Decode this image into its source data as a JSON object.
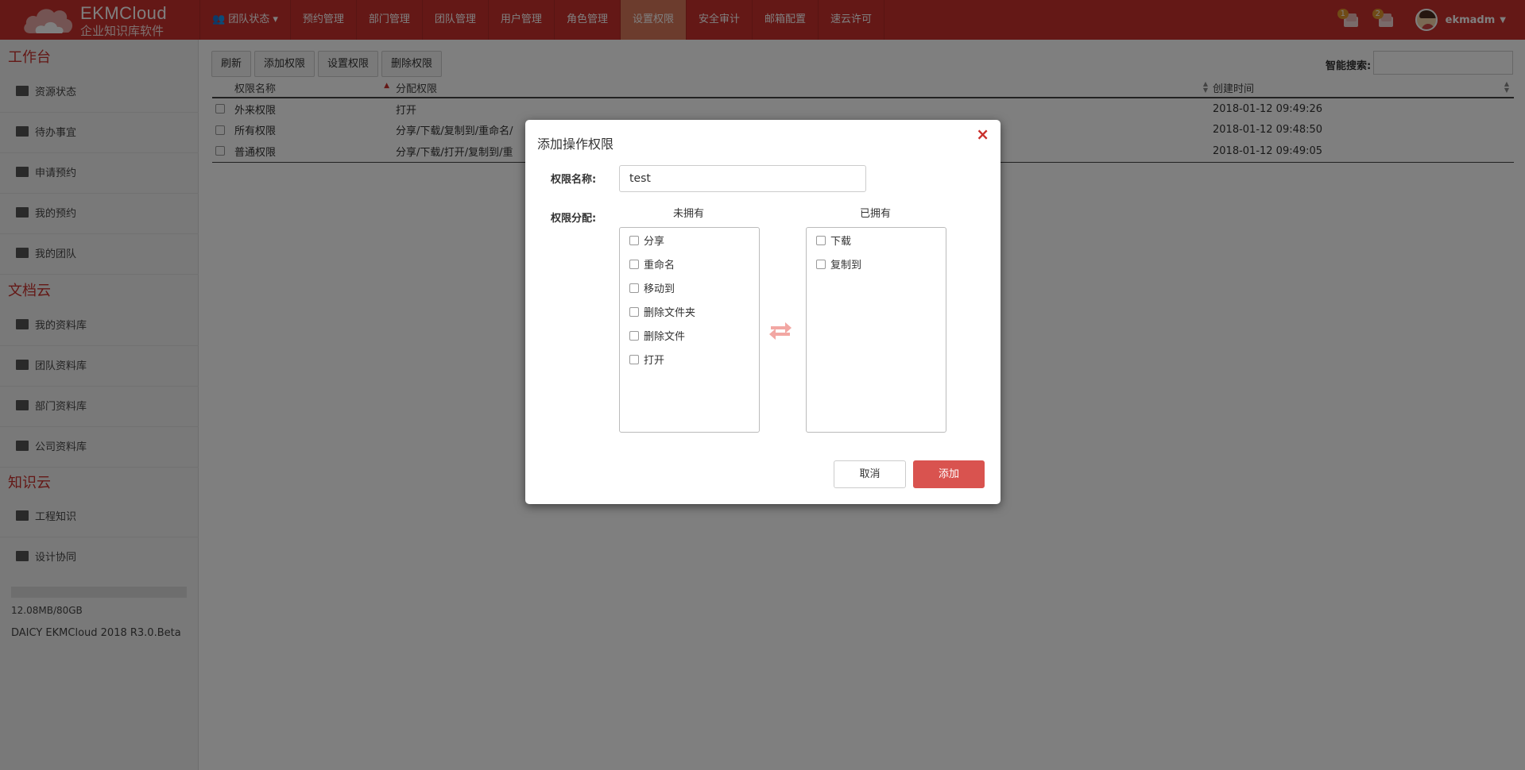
{
  "header": {
    "brand": "EKMCloud",
    "subtitle": "企业知识库软件",
    "nav": [
      {
        "label": "团队状态",
        "icon": "team-icon",
        "has_dropdown": true
      },
      {
        "label": "预约管理"
      },
      {
        "label": "部门管理"
      },
      {
        "label": "团队管理"
      },
      {
        "label": "用户管理"
      },
      {
        "label": "角色管理"
      },
      {
        "label": "设置权限",
        "active": true
      },
      {
        "label": "安全审计"
      },
      {
        "label": "邮箱配置"
      },
      {
        "label": "速云许可"
      }
    ],
    "messages": [
      {
        "count": "1"
      },
      {
        "count": "2"
      }
    ],
    "username": "ekmadm"
  },
  "sidebar": {
    "sections": [
      {
        "title": "工作台",
        "items": [
          "资源状态",
          "待办事宜",
          "申请预约",
          "我的预约",
          "我的团队"
        ]
      },
      {
        "title": "文档云",
        "items": [
          "我的资料库",
          "团队资料库",
          "部门资料库",
          "公司资料库"
        ]
      },
      {
        "title": "知识云",
        "items": [
          "工程知识",
          "设计协同"
        ]
      }
    ],
    "storage": "12.08MB/80GB",
    "version": "DAICY EKMCloud 2018 R3.0.Beta"
  },
  "toolbar": {
    "buttons": [
      "刷新",
      "添加权限",
      "设置权限",
      "删除权限"
    ],
    "search_label": "智能搜索:",
    "search_value": ""
  },
  "table": {
    "columns": [
      "权限名称",
      "分配权限",
      "创建时间"
    ],
    "rows": [
      {
        "name": "外来权限",
        "perms": "打开",
        "created": "2018-01-12 09:49:26"
      },
      {
        "name": "所有权限",
        "perms": "分享/下载/复制到/重命名/",
        "created": "2018-01-12 09:48:50"
      },
      {
        "name": "普通权限",
        "perms": "分享/下载/打开/复制到/重",
        "created": "2018-01-12 09:49:05"
      }
    ]
  },
  "modal": {
    "title": "添加操作权限",
    "close_glyph": "×",
    "name_label": "权限名称:",
    "name_value": "test",
    "assign_label": "权限分配:",
    "unowned_title": "未拥有",
    "owned_title": "已拥有",
    "unowned": [
      "分享",
      "重命名",
      "移动到",
      "删除文件夹",
      "删除文件",
      "打开"
    ],
    "owned": [
      "下载",
      "复制到"
    ],
    "cancel_label": "取消",
    "add_label": "添加"
  },
  "colors": {
    "brand": "#c9302c",
    "active_tab": "#d9795b",
    "primary_button": "#d9534f"
  }
}
